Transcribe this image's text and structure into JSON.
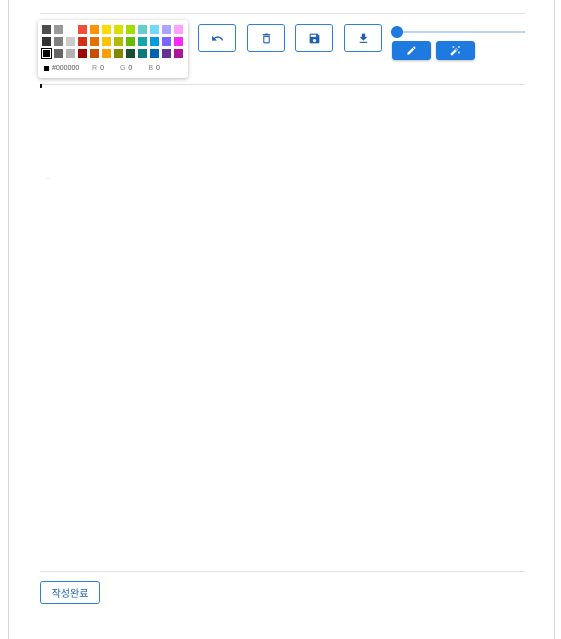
{
  "palette": {
    "rows": [
      [
        "#4d4d4d",
        "#999999",
        "#ffffff",
        "#f44e3b",
        "#fe9200",
        "#fcdc00",
        "#dbdf00",
        "#a4dd00",
        "#68ccca",
        "#73d8ff",
        "#aea1ff",
        "#fda1ff"
      ],
      [
        "#333333",
        "#808080",
        "#cccccc",
        "#d33115",
        "#e27300",
        "#fcc400",
        "#b0bc00",
        "#68bc00",
        "#16a5a5",
        "#009ce0",
        "#7b64ff",
        "#fa28ff"
      ],
      [
        "#000000",
        "#666666",
        "#b3b3b3",
        "#9f0500",
        "#c45100",
        "#fb9e00",
        "#808900",
        "#194d33",
        "#0c797d",
        "#0062b1",
        "#653294",
        "#ab149e"
      ]
    ],
    "selected": "#000000",
    "hex": "#000000",
    "r_label": "R",
    "r": "0",
    "g_label": "G",
    "g": "0",
    "b_label": "B",
    "b": "0"
  },
  "toolbar": {
    "accent": "#1f7ae0",
    "buttons": [
      {
        "name": "undo-button",
        "icon": "undo-icon"
      },
      {
        "name": "clear-button",
        "icon": "trash-icon"
      },
      {
        "name": "save-button",
        "icon": "floppy-disk-icon"
      },
      {
        "name": "download-button",
        "icon": "download-icon"
      }
    ],
    "brush_size_percent": 0,
    "modes": [
      {
        "name": "pen-mode-button",
        "icon": "pencil-icon"
      },
      {
        "name": "magic-mode-button",
        "icon": "magic-wand-icon"
      }
    ]
  },
  "footer": {
    "submit_label": "작성완료"
  }
}
